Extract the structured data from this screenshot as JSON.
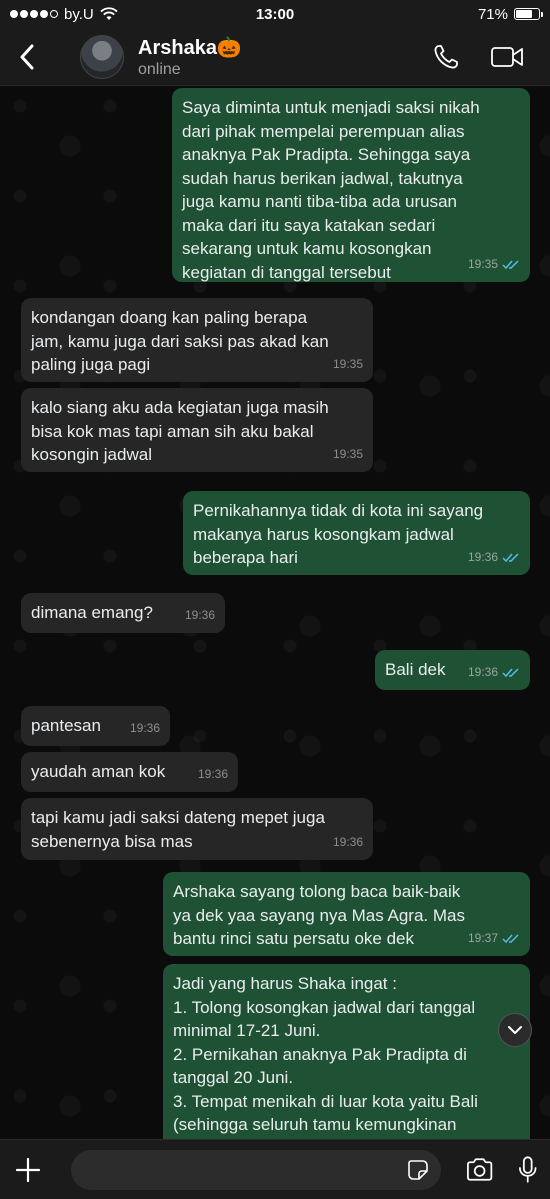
{
  "status_bar": {
    "carrier": "by.U",
    "time": "13:00",
    "battery": "71%",
    "battery_level": 0.71
  },
  "header": {
    "name": "Arshaka🎃",
    "status": "online"
  },
  "messages": [
    {
      "dir": "out",
      "text": "Saya diminta untuk menjadi saksi nikah\ndari pihak mempelai perempuan alias\nanaknya Pak Pradipta. Sehingga saya\nsudah harus berikan jadwal, takutnya\njuga kamu nanti tiba-tiba ada urusan\nmaka dari itu saya katakan sedari\nsekarang untuk kamu kosongkan\nkegiatan di tanggal tersebut",
      "time": "19:35"
    },
    {
      "dir": "in",
      "text": "kondangan doang kan paling berapa\njam, kamu juga dari saksi pas akad kan\npaling juga pagi",
      "time": "19:35"
    },
    {
      "dir": "in",
      "text": "kalo siang aku ada kegiatan juga masih\nbisa kok mas tapi aman sih aku bakal\nkosongin jadwal",
      "time": "19:35"
    },
    {
      "dir": "out",
      "text": "Pernikahannya tidak di kota ini sayang\nmakanya harus kosongkam jadwal\nbeberapa hari",
      "time": "19:36"
    },
    {
      "dir": "in",
      "text": "dimana emang?",
      "time": "19:36"
    },
    {
      "dir": "out",
      "text": "Bali dek",
      "time": "19:36"
    },
    {
      "dir": "in",
      "text": "pantesan",
      "time": "19:36"
    },
    {
      "dir": "in",
      "text": "yaudah aman kok",
      "time": "19:36"
    },
    {
      "dir": "in",
      "text": "tapi kamu jadi saksi dateng mepet juga\nsebenernya bisa mas",
      "time": "19:36"
    },
    {
      "dir": "out",
      "text": "Arshaka sayang tolong baca baik-baik\nya dek yaa sayang nya Mas Agra. Mas\nbantu rinci satu persatu oke dek",
      "time": "19:37"
    },
    {
      "dir": "out",
      "text": "Jadi yang harus Shaka ingat :\n1. Tolong kosongkan jadwal dari tanggal\nminimal 17-21 Juni.\n2. Pernikahan anaknya Pak Pradipta di\ntanggal 20 Juni.\n3. Tempat menikah di luar kota yaitu Bali\n(sehingga seluruh tamu kemungkinan",
      "time": ""
    }
  ],
  "input": {
    "placeholder": ""
  },
  "icons": {
    "back": "chevron-left-icon",
    "call": "phone-icon",
    "video": "video-camera-icon",
    "plus": "plus-icon",
    "sticker": "sticker-icon",
    "camera": "camera-icon",
    "mic": "microphone-icon",
    "scroll": "chevron-down-icon",
    "read": "double-check-icon"
  },
  "colors": {
    "outgoing": "#1f5134",
    "incoming": "#262626",
    "ticks": "#53bdeb"
  }
}
